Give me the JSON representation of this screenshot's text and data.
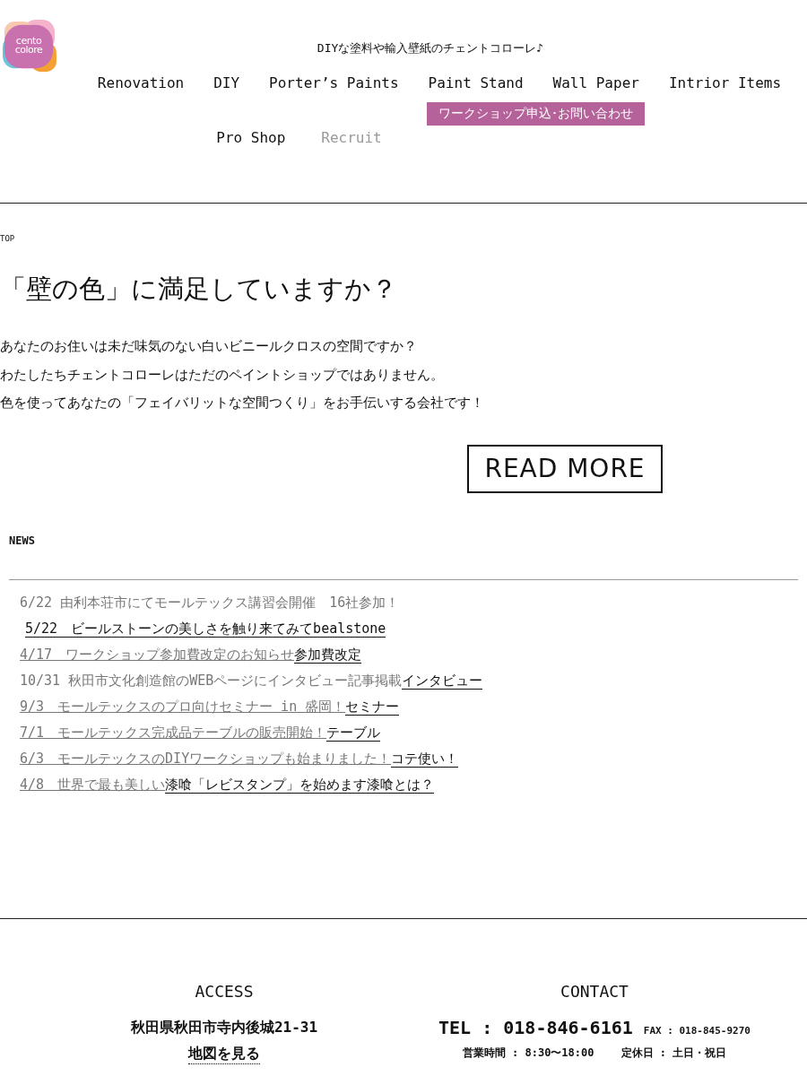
{
  "logo": {
    "line1": "cento",
    "line2": "colore"
  },
  "tagline": "DIYな塗料や輸入壁紙のチェントコローレ♪",
  "nav": [
    {
      "label": "Renovation",
      "muted": false
    },
    {
      "label": "DIY",
      "muted": false
    },
    {
      "label": "Porter’s Paints",
      "muted": false
    },
    {
      "label": "Paint Stand",
      "muted": false
    },
    {
      "label": "Wall Paper",
      "muted": false
    },
    {
      "label": "Intrior Items",
      "muted": false
    },
    {
      "label": "Pro Shop",
      "muted": false
    },
    {
      "label": "Recruit",
      "muted": true
    }
  ],
  "contact_button": "ワークショップ申込･お問い合わせ",
  "breadcrumb": "TOP",
  "heading": "「壁の色」に満足していますか？",
  "intro": [
    "あなたのお住いは未だ味気のない白いビニールクロスの空間ですか？",
    "わたしたちチェントコローレはただのペイントショップではありません。",
    "色を使ってあなたの「フェイバリットな空間つくり」をお手伝いする会社です！"
  ],
  "read_more": "READ MORE",
  "news_label": "NEWS",
  "news": [
    {
      "indent": false,
      "parts": [
        {
          "kind": "plain",
          "text": "6/22 由利本荘市にてモールテックス講習会開催　16社参加！"
        }
      ]
    },
    {
      "indent": true,
      "parts": [
        {
          "kind": "link",
          "text": "5/22　ビールストーンの美しさを触り来てみてbealstone"
        }
      ]
    },
    {
      "indent": false,
      "parts": [
        {
          "kind": "muted-link",
          "text": "4/17　ワークショップ参加費改定のお知らせ"
        },
        {
          "kind": "link",
          "text": "参加費改定"
        }
      ]
    },
    {
      "indent": false,
      "parts": [
        {
          "kind": "plain",
          "text": "10/31 秋田市文化創造館のWEBページにインタビュー記事掲載"
        },
        {
          "kind": "link",
          "text": "インタビュー"
        }
      ]
    },
    {
      "indent": false,
      "parts": [
        {
          "kind": "muted-link",
          "text": "9/3　モールテックスのプロ向けセミナー in 盛岡！"
        },
        {
          "kind": "link",
          "text": "セミナー"
        }
      ]
    },
    {
      "indent": false,
      "parts": [
        {
          "kind": "muted-link",
          "text": "7/1　モールテックス完成品テーブルの販売開始！"
        },
        {
          "kind": "link",
          "text": "テーブル"
        }
      ]
    },
    {
      "indent": false,
      "parts": [
        {
          "kind": "muted-link",
          "text": "6/3　モールテックスのDIYワークショップも始まりました！"
        },
        {
          "kind": "link",
          "text": "コテ使い！"
        }
      ]
    },
    {
      "indent": false,
      "parts": [
        {
          "kind": "muted-link",
          "text": "4/8　世界で最も美しい"
        },
        {
          "kind": "link",
          "text": "漆喰「レビスタンプ」を始めます漆喰とは？"
        }
      ]
    }
  ],
  "access": {
    "title": "ACCESS",
    "address": "秋田県秋田市寺内後城21-31",
    "map_link": "地図を見る"
  },
  "contact": {
    "title": "CONTACT",
    "tel": "TEL : 018-846-6161",
    "fax": "FAX : 018-845-9270",
    "hours": "営業時間 : 8:30〜18:00",
    "holiday": "定休日 : 土日・祝日"
  }
}
